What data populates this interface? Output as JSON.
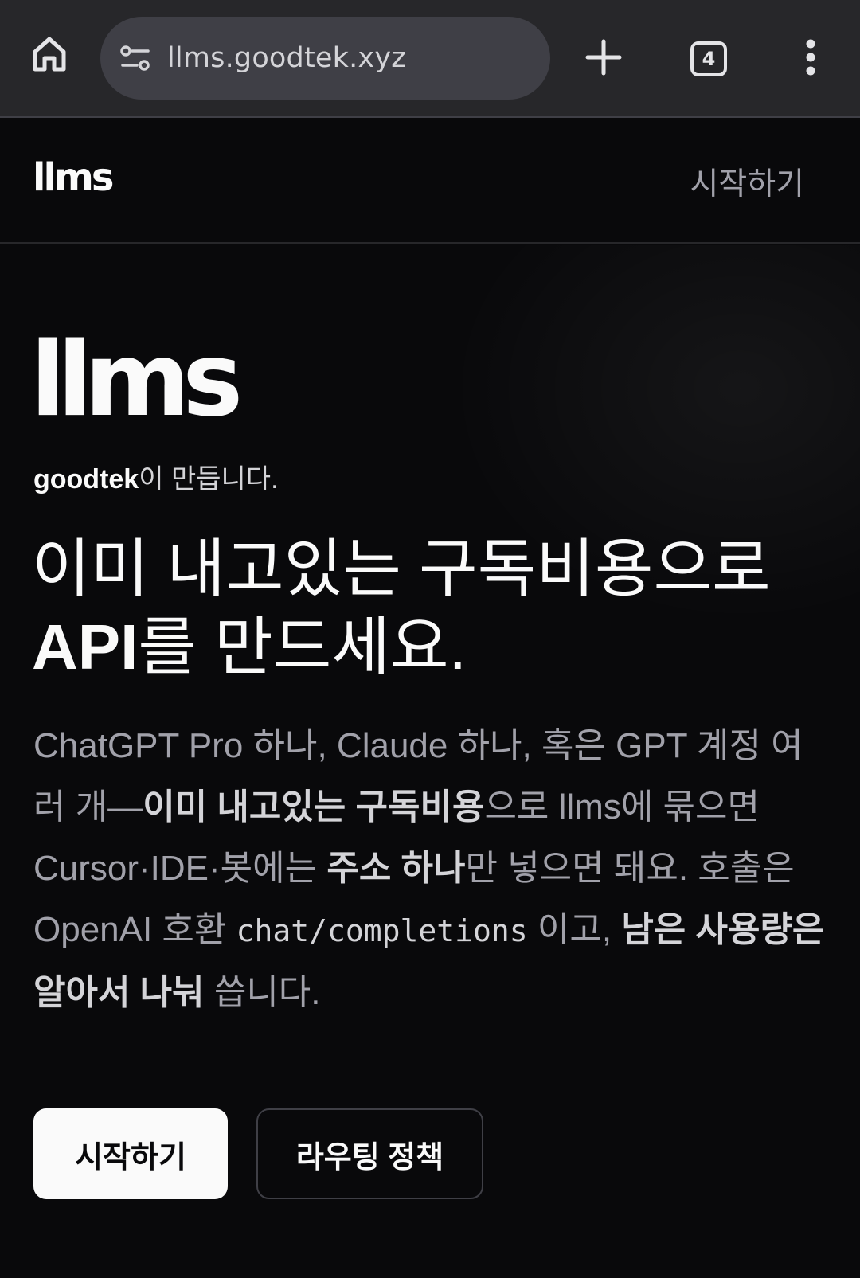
{
  "browser": {
    "url": "llms.goodtek.xyz",
    "tab_count": "4",
    "icons": [
      "home-icon",
      "site-info-icon",
      "plus-icon",
      "tab-switcher-icon",
      "more-vert-icon"
    ]
  },
  "nav": {
    "logo": "llms",
    "start_link": "시작하기"
  },
  "hero": {
    "logo": "llms",
    "made_by_brand": "goodtek",
    "made_by_suffix": "이 만듭니다.",
    "headline_line1": "이미 내고있는 구독비용으로",
    "headline_line2_strong": "API",
    "headline_line2_rest": "를 만드세요.",
    "desc": {
      "p1": "ChatGPT Pro 하나, Claude 하나, 혹은 GPT 계정 여러 개—",
      "b1": "이미 내고있는 구독비용",
      "p2": "으로 llms에 묶으면 Cursor·IDE·봇에는 ",
      "b2": "주소 하나",
      "p3": "만 넣으면 돼요. 호출은 OpenAI 호환 ",
      "code": "chat/completions",
      "p4": " 이고, ",
      "b3": "남은 사용량은 알아서 나눠",
      "p5": " 씁니다."
    },
    "primary_button": "시작하기",
    "secondary_button": "라우팅 정책"
  },
  "colors": {
    "background": "#09090b",
    "chrome": "#27272a",
    "url_bar": "#3f3f46",
    "text_primary": "#fafafa",
    "text_muted": "#a1a1aa",
    "button_primary_bg": "#fafafa"
  }
}
